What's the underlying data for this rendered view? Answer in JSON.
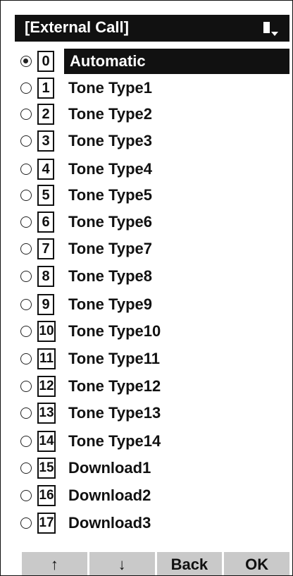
{
  "title": "[External Call]",
  "items": [
    {
      "key": "0",
      "label": "Automatic",
      "selected": true
    },
    {
      "key": "1",
      "label": "Tone Type1"
    },
    {
      "key": "2",
      "label": "Tone Type2"
    },
    {
      "key": "3",
      "label": "Tone Type3"
    },
    {
      "key": "4",
      "label": "Tone Type4"
    },
    {
      "key": "5",
      "label": "Tone Type5"
    },
    {
      "key": "6",
      "label": "Tone Type6"
    },
    {
      "key": "7",
      "label": "Tone Type7"
    },
    {
      "key": "8",
      "label": "Tone Type8"
    },
    {
      "key": "9",
      "label": "Tone Type9"
    },
    {
      "key": "10",
      "label": "Tone Type10"
    },
    {
      "key": "11",
      "label": "Tone Type11"
    },
    {
      "key": "12",
      "label": "Tone Type12"
    },
    {
      "key": "13",
      "label": "Tone Type13"
    },
    {
      "key": "14",
      "label": "Tone Type14"
    },
    {
      "key": "15",
      "label": "Download1"
    },
    {
      "key": "16",
      "label": "Download2"
    },
    {
      "key": "17",
      "label": "Download3"
    }
  ],
  "softkeys": {
    "up": "↑",
    "down": "↓",
    "back": "Back",
    "ok": "OK"
  }
}
